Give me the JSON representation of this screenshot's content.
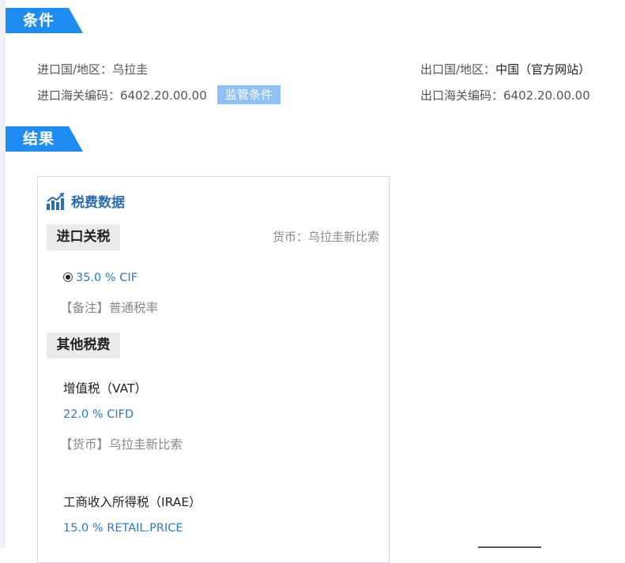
{
  "sections": {
    "conditions_label": "条件",
    "results_label": "结果"
  },
  "conditions": {
    "import_country_label": "进口国/地区：",
    "import_country_value": "乌拉圭",
    "export_country_label": "出口国/地区：",
    "export_country_value": "中国（官方网站）",
    "import_hs_label": "进口海关编码：",
    "import_hs_value": "6402.20.00.00",
    "export_hs_label": "出口海关编码：",
    "export_hs_value": "6402.20.00.00",
    "regulatory_button": "监管条件"
  },
  "panel": {
    "title": "税费数据",
    "import_duty": {
      "heading": "进口关税",
      "currency_note": "货币：乌拉圭新比索",
      "rate": "35.0 % CIF",
      "remark": "【备注】普通税率"
    },
    "other_taxes": {
      "heading": "其他税费",
      "items": [
        {
          "name": "增值税（VAT）",
          "rate": "22.0 % CIFD",
          "note": "【货币】乌拉圭新比索"
        },
        {
          "name": "工商收入所得税（IRAE）",
          "rate": "15.0 % RETAIL.PRICE"
        }
      ]
    }
  },
  "colors": {
    "accent": "#1e8cf0",
    "button": "#8fc1f4",
    "link": "#2b78c9"
  }
}
